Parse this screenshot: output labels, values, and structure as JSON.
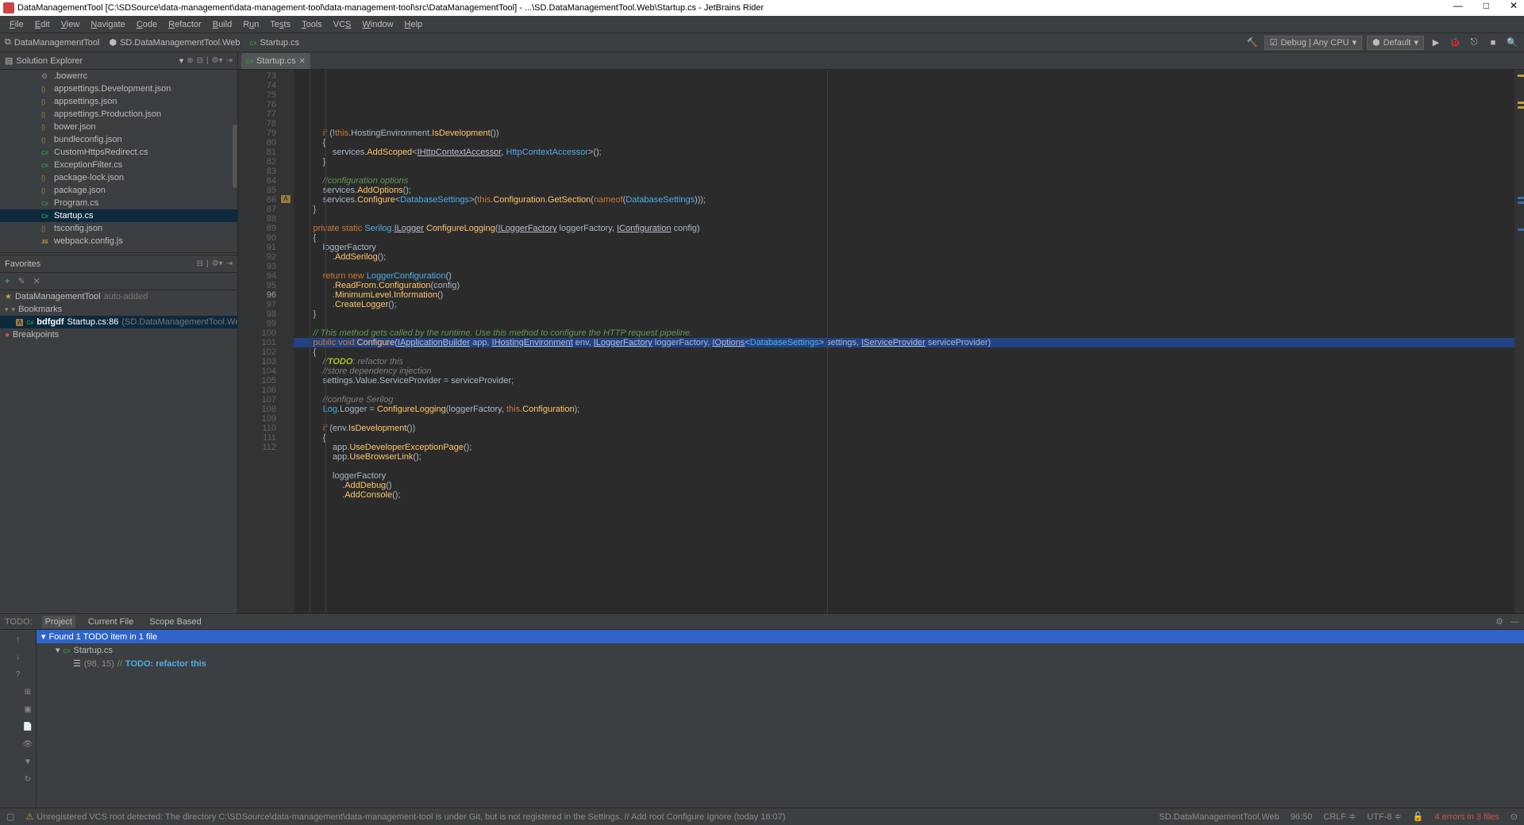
{
  "window_title": "DataManagementTool [C:\\SDSource\\data-management\\data-management-tool\\data-management-tool\\src\\DataManagementTool] - ...\\SD.DataManagementTool.Web\\Startup.cs - JetBrains Rider",
  "menu": [
    "File",
    "Edit",
    "View",
    "Navigate",
    "Code",
    "Refactor",
    "Build",
    "Run",
    "Tests",
    "Tools",
    "VCS",
    "Window",
    "Help"
  ],
  "breadcrumbs": [
    "DataManagementTool",
    "SD.DataManagementTool.Web",
    "Startup.cs"
  ],
  "run_config": {
    "debug": "Debug | Any CPU",
    "target": "Default"
  },
  "solution": {
    "header": "Solution Explorer",
    "items": [
      {
        "name": ".bowerrc",
        "icon": "cfg"
      },
      {
        "name": "appsettings.Development.json",
        "icon": "json"
      },
      {
        "name": "appsettings.json",
        "icon": "json"
      },
      {
        "name": "appsettings.Production.json",
        "icon": "json"
      },
      {
        "name": "bower.json",
        "icon": "json"
      },
      {
        "name": "bundleconfig.json",
        "icon": "json"
      },
      {
        "name": "CustomHttpsRedirect.cs",
        "icon": "cs"
      },
      {
        "name": "ExceptionFilter.cs",
        "icon": "cs"
      },
      {
        "name": "package-lock.json",
        "icon": "json"
      },
      {
        "name": "package.json",
        "icon": "json"
      },
      {
        "name": "Program.cs",
        "icon": "cs"
      },
      {
        "name": "Startup.cs",
        "icon": "cs",
        "selected": true
      },
      {
        "name": "tsconfig.json",
        "icon": "json"
      },
      {
        "name": "webpack.config.js",
        "icon": "js"
      }
    ]
  },
  "favorites": {
    "header": "Favorites",
    "items": [
      {
        "type": "group",
        "label": "DataManagementTool",
        "suffix": "auto-added",
        "icon": "star"
      },
      {
        "type": "group",
        "label": "Bookmarks",
        "icon": "v"
      },
      {
        "type": "bookmark",
        "prefix": "A",
        "name": "bdfgdf",
        "loc": "Startup.cs:86",
        "path": "(SD.DataManagementTool.Web/Start"
      },
      {
        "type": "group",
        "label": "Breakpoints",
        "icon": "bp"
      }
    ]
  },
  "editor": {
    "tab": "Startup.cs",
    "first_line": 73,
    "current_line": 96,
    "lines": [
      "",
      "            if (!this.HostingEnvironment.IsDevelopment())",
      "            {",
      "                services.AddScoped<IHttpContextAccessor, HttpContextAccessor>();",
      "            }",
      "",
      "            //configuration options",
      "            services.AddOptions();",
      "            services.Configure<DatabaseSettings>(this.Configuration.GetSection(nameof(DatabaseSettings)));",
      "        }",
      "",
      "        private static Serilog.ILogger ConfigureLogging(ILoggerFactory loggerFactory, IConfiguration config)",
      "        {",
      "            loggerFactory",
      "                .AddSerilog();",
      "",
      "            return new LoggerConfiguration()",
      "                .ReadFrom.Configuration(config)",
      "                .MinimumLevel.Information()",
      "                .CreateLogger();",
      "        }",
      "",
      "        // This method gets called by the runtime. Use this method to configure the HTTP request pipeline.",
      "        public void Configure(IApplicationBuilder app, IHostingEnvironment env, ILoggerFactory loggerFactory, IOptions<DatabaseSettings> settings, IServiceProvider serviceProvider)",
      "        {",
      "            //TODO: refactor this",
      "            //store dependency injection",
      "            settings.Value.ServiceProvider = serviceProvider;",
      "",
      "            //configure Serilog",
      "            Log.Logger = ConfigureLogging(loggerFactory, this.Configuration);",
      "",
      "            if (env.IsDevelopment())",
      "            {",
      "                app.UseDeveloperExceptionPage();",
      "                app.UseBrowserLink();",
      "",
      "                loggerFactory",
      "                    .AddDebug()",
      "                    .AddConsole();"
    ]
  },
  "todo": {
    "tabs_label": "TODO:",
    "tabs": [
      "Project",
      "Current File",
      "Scope Based"
    ],
    "active_tab": 0,
    "found": "Found 1 TODO item in 1 file",
    "file": "Startup.cs",
    "loc": "(98, 15)",
    "comment": "//",
    "todo_text": "TODO: refactor this"
  },
  "status": {
    "vcs_msg": "Unregistered VCS root detected: The directory C:\\SDSource\\data-management\\data-management-tool is under Git, but is not registered in the Settings.",
    "actions": "// Add root  Configure  Ignore (today 16:07)",
    "project": "SD.DataManagementTool.Web",
    "caret": "96:50",
    "eol": "CRLF",
    "enc": "UTF-8",
    "insp": "4 errors in 3 files"
  }
}
